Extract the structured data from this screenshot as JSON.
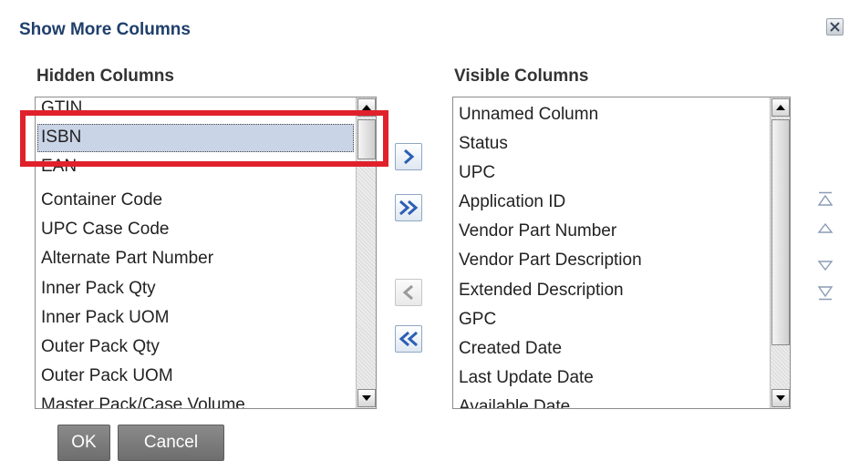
{
  "dialog": {
    "title": "Show More Columns",
    "close_icon": "close-icon"
  },
  "hidden": {
    "label": "Hidden Columns",
    "items": [
      "GTIN",
      "ISBN",
      "EAN",
      "Container Code",
      "UPC Case Code",
      "Alternate Part Number",
      "Inner Pack Qty",
      "Inner Pack UOM",
      "Outer Pack Qty",
      "Outer Pack UOM",
      "Master Pack/Case Volume"
    ],
    "selected": "ISBN"
  },
  "visible": {
    "label": "Visible Columns",
    "items": [
      "Unnamed Column",
      "Status",
      "UPC",
      "Application ID",
      "Vendor Part Number",
      "Vendor Part Description",
      "Extended Description",
      "GPC",
      "Created Date",
      "Last Update Date",
      "Available Date"
    ]
  },
  "transfer_icons": [
    "move-right-icon",
    "move-all-right-icon",
    "move-left-icon",
    "move-all-left-icon"
  ],
  "order_icons": [
    "move-to-top-icon",
    "move-up-icon",
    "move-down-icon",
    "move-to-bottom-icon"
  ],
  "buttons": {
    "ok": "OK",
    "cancel": "Cancel"
  },
  "colors": {
    "title": "#1f3f6b",
    "highlight": "#e0212b",
    "selection": "#c9d4e6",
    "button": "#7a7a7a"
  }
}
